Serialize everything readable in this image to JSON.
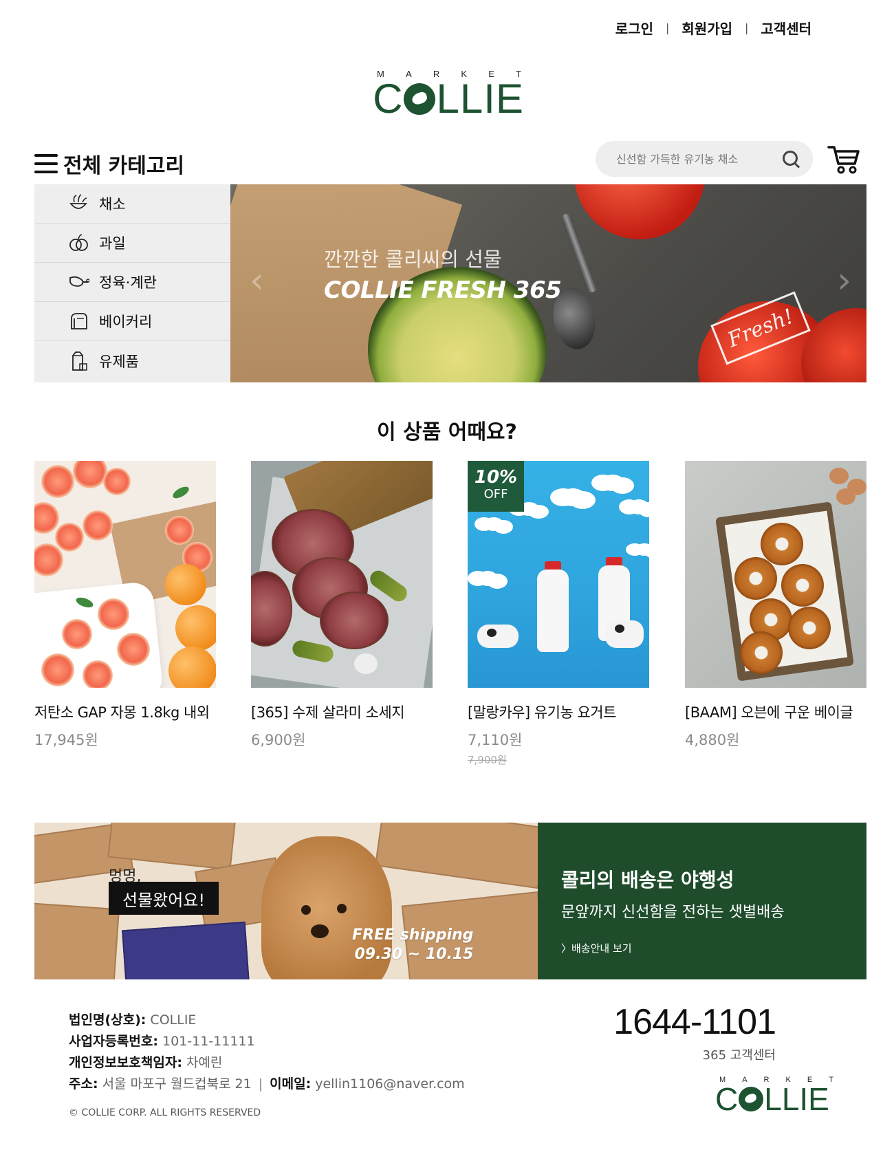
{
  "header": {
    "links": [
      "로그인",
      "회원가입",
      "고객센터"
    ],
    "separator": "|"
  },
  "logo": {
    "market": [
      "M",
      "A",
      "R",
      "K",
      "E",
      "T"
    ],
    "name_pre": "C",
    "name_post": "LLIE",
    "brand_color": "#1d5330"
  },
  "category_header": "전체 카테고리",
  "search": {
    "placeholder": "신선함 가득한 유기농 채소"
  },
  "sidebar": {
    "items": [
      {
        "label": "채소",
        "icon": "vegetable-icon"
      },
      {
        "label": "과일",
        "icon": "fruit-icon"
      },
      {
        "label": "정육·계란",
        "icon": "meat-icon"
      },
      {
        "label": "베이커리",
        "icon": "bread-icon"
      },
      {
        "label": "유제품",
        "icon": "dairy-icon"
      }
    ]
  },
  "hero": {
    "subtitle": "깐깐한 콜리씨의 선물",
    "title": "COLLIE FRESH 365",
    "stamp": "Fresh!",
    "prev": "‹",
    "next": "›"
  },
  "section_title": "이 상품 어때요?",
  "products": [
    {
      "name": "저탄소 GAP 자몽 1.8kg 내외",
      "price": "17,945원"
    },
    {
      "name": "[365] 수제 살라미 소세지",
      "price": "6,900원"
    },
    {
      "name": "[말랑카우] 유기농 요거트",
      "price": "7,110원",
      "original_price": "7,900원",
      "badge_pct": "10%",
      "badge_off": "OFF"
    },
    {
      "name": "[BAAM] 오븐에 구운 베이글",
      "price": "4,880원"
    }
  ],
  "delivery": {
    "bark": "멍멍,",
    "gift": "선물왔어요!",
    "free_line1": "FREE shipping",
    "free_line2": "09.30 ~ 10.15",
    "heading": "콜리의 배송은 야행성",
    "sub": "문앞까지 신선함을 전하는 샛별배송",
    "link": "〉배송안내 보기",
    "color": "#1f4d2c"
  },
  "footer": {
    "company_label": "법인명(상호):",
    "company": "COLLIE",
    "biz_label": "사업자등록번호:",
    "biz": "101-11-11111",
    "privacy_label": "개인정보보호책임자:",
    "privacy": "차예린",
    "address_label": "주소:",
    "address": "서울 마포구 월드컵북로 21",
    "email_label": "이메일:",
    "email": "yellin1106@naver.com",
    "copyright": "© COLLIE CORP. ALL RIGHTS RESERVED",
    "phone": "1644-1101",
    "phone_label": "365 고객센터"
  }
}
